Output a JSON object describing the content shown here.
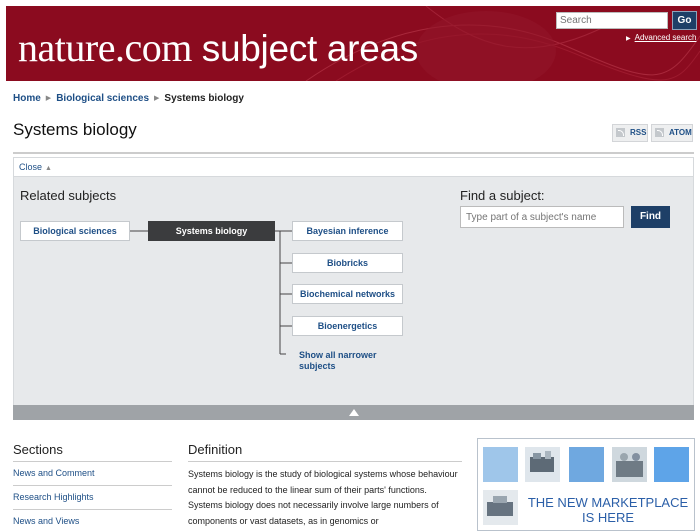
{
  "header": {
    "logo_main": "nature.com",
    "logo_sub": "subject areas",
    "search_placeholder": "Search",
    "go_label": "Go",
    "advanced_search": "Advanced search",
    "bg_color": "#8b0b1f"
  },
  "breadcrumb": {
    "items": [
      "Home",
      "Biological sciences",
      "Systems biology"
    ]
  },
  "page_title": "Systems biology",
  "feeds": {
    "rss": "RSS",
    "atom": "ATOM"
  },
  "related": {
    "close_label": "Close",
    "heading": "Related subjects",
    "parent": "Biological sciences",
    "current": "Systems biology",
    "children": [
      "Bayesian inference",
      "Biobricks",
      "Biochemical networks",
      "Bioenergetics"
    ],
    "show_all": "Show all narrower subjects"
  },
  "find": {
    "heading": "Find a subject:",
    "placeholder": "Type part of a subject's name",
    "button": "Find"
  },
  "sections": {
    "heading": "Sections",
    "items": [
      "News and Comment",
      "Research Highlights",
      "News and Views"
    ]
  },
  "definition": {
    "heading": "Definition",
    "text": "Systems biology is the study of biological systems whose behaviour cannot be reduced to the linear sum of their parts' functions. Systems biology does not necessarily involve large numbers of components or vast datasets, as in genomics or"
  },
  "ad": {
    "text": "THE NEW MARKETPLACE IS HERE",
    "accent": "#2b5fa8"
  }
}
